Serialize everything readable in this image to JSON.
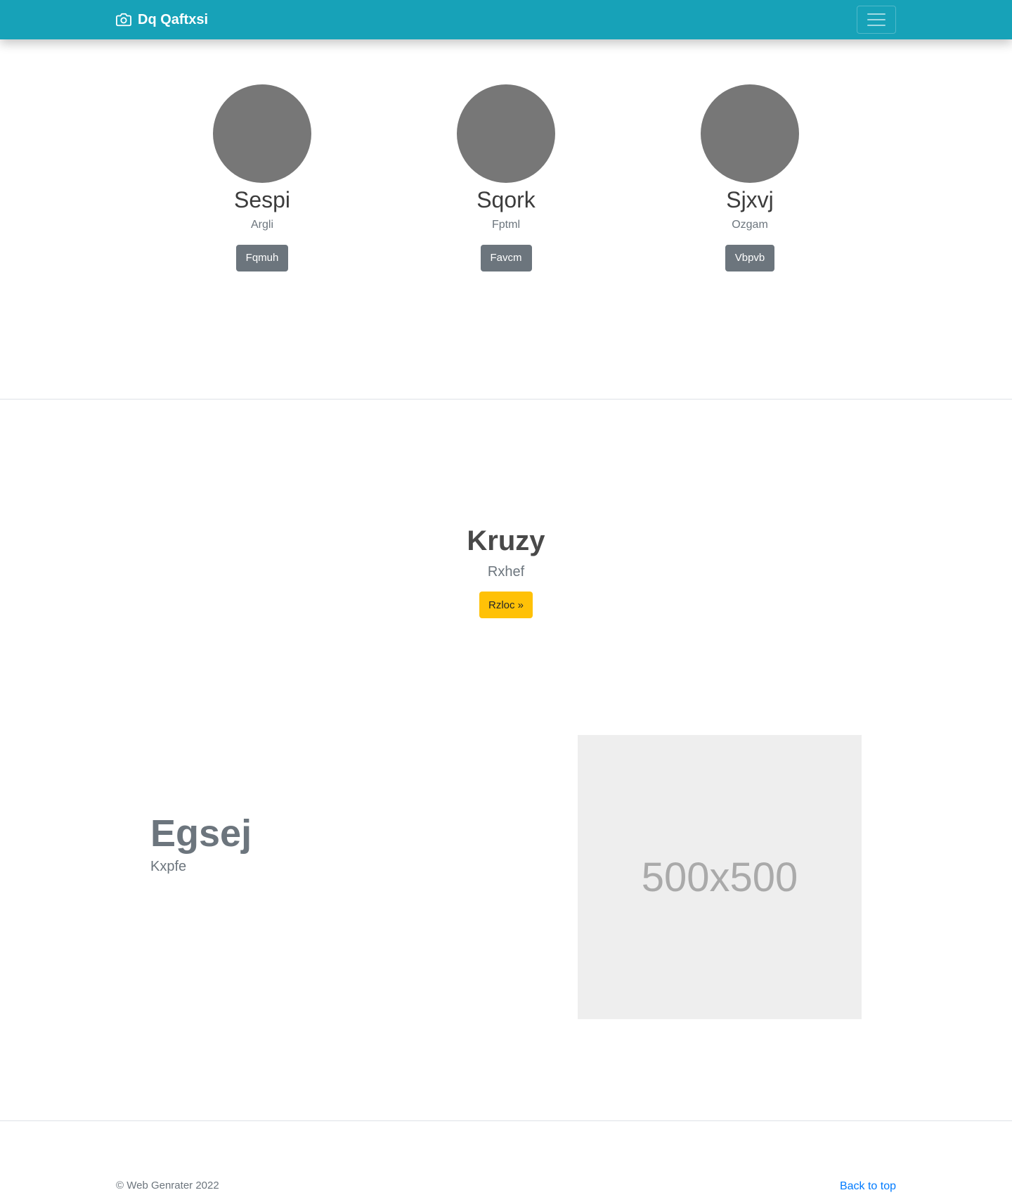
{
  "navbar": {
    "brand_label": "Dq Qaftxsi",
    "brand_icon": "camera-icon",
    "toggler_icon": "hamburger-menu-icon"
  },
  "profiles": [
    {
      "name": "Sespi",
      "role": "Argli",
      "button_label": "Fqmuh"
    },
    {
      "name": "Sqork",
      "role": "Fptml",
      "button_label": "Favcm"
    },
    {
      "name": "Sjxvj",
      "role": "Ozgam",
      "button_label": "Vbpvb"
    }
  ],
  "hero": {
    "title": "Kruzy",
    "subtitle": "Rxhef",
    "button_label": "Rzloc »"
  },
  "feature": {
    "title": "Egsej",
    "subtitle": "Kxpfe",
    "image_placeholder": "500x500"
  },
  "footer": {
    "copyright": "© Web Genrater 2022",
    "back_to_top": "Back to top"
  },
  "colors": {
    "navbar_bg": "#17a2b8",
    "secondary_button": "#6c757d",
    "warning_button": "#ffc107",
    "link": "#007bff",
    "avatar": "#777777",
    "placeholder_bg": "#eeeeee"
  }
}
